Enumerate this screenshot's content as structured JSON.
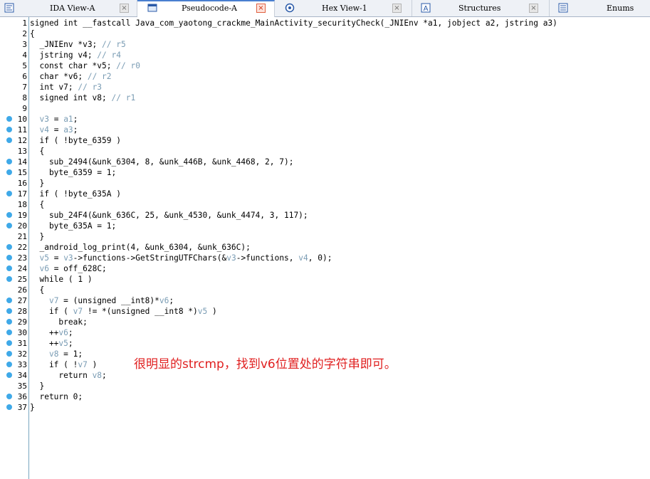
{
  "tabs": [
    {
      "label": "IDA View-A",
      "icon": "ida-view-icon",
      "active": false
    },
    {
      "label": "Pseudocode-A",
      "icon": "pseudocode-icon",
      "active": true
    },
    {
      "label": "Hex View-1",
      "icon": "hex-view-icon",
      "active": false
    },
    {
      "label": "Structures",
      "icon": "structures-icon",
      "active": false
    },
    {
      "label": "Enums",
      "icon": "enums-icon",
      "active": false
    }
  ],
  "close_glyph": "×",
  "colors": {
    "breakpoint_dot": "#3fa9e8",
    "variable": "#7a9cb4",
    "annotation": "#e02020"
  },
  "code_lines": [
    {
      "n": "1",
      "dot": false,
      "tokens": [
        [
          "t",
          "signed int __fastcall Java_com_yaotong_crackme_MainActivity_securityCheck(_JNIEnv *a1, jobject a2, jstring a3)"
        ]
      ]
    },
    {
      "n": "2",
      "dot": false,
      "tokens": [
        [
          "t",
          "{"
        ]
      ]
    },
    {
      "n": "3",
      "dot": false,
      "tokens": [
        [
          "t",
          "  _JNIEnv *v3; "
        ],
        [
          "c",
          "// r5"
        ]
      ]
    },
    {
      "n": "4",
      "dot": false,
      "tokens": [
        [
          "t",
          "  jstring v4; "
        ],
        [
          "c",
          "// r4"
        ]
      ]
    },
    {
      "n": "5",
      "dot": false,
      "tokens": [
        [
          "t",
          "  const char *v5; "
        ],
        [
          "c",
          "// r0"
        ]
      ]
    },
    {
      "n": "6",
      "dot": false,
      "tokens": [
        [
          "t",
          "  char *v6; "
        ],
        [
          "c",
          "// r2"
        ]
      ]
    },
    {
      "n": "7",
      "dot": false,
      "tokens": [
        [
          "t",
          "  int v7; "
        ],
        [
          "c",
          "// r3"
        ]
      ]
    },
    {
      "n": "8",
      "dot": false,
      "tokens": [
        [
          "t",
          "  signed int v8; "
        ],
        [
          "c",
          "// r1"
        ]
      ]
    },
    {
      "n": "9",
      "dot": false,
      "tokens": [
        [
          "t",
          ""
        ]
      ]
    },
    {
      "n": "10",
      "dot": true,
      "tokens": [
        [
          "t",
          "  "
        ],
        [
          "v",
          "v3"
        ],
        [
          "t",
          " = "
        ],
        [
          "v",
          "a1"
        ],
        [
          "t",
          ";"
        ]
      ]
    },
    {
      "n": "11",
      "dot": true,
      "tokens": [
        [
          "t",
          "  "
        ],
        [
          "v",
          "v4"
        ],
        [
          "t",
          " = "
        ],
        [
          "v",
          "a3"
        ],
        [
          "t",
          ";"
        ]
      ]
    },
    {
      "n": "12",
      "dot": true,
      "tokens": [
        [
          "t",
          "  if ( !byte_6359 )"
        ]
      ]
    },
    {
      "n": "13",
      "dot": false,
      "tokens": [
        [
          "t",
          "  {"
        ]
      ]
    },
    {
      "n": "14",
      "dot": true,
      "tokens": [
        [
          "t",
          "    sub_2494(&unk_6304, 8, &unk_446B, &unk_4468, 2, 7);"
        ]
      ]
    },
    {
      "n": "15",
      "dot": true,
      "tokens": [
        [
          "t",
          "    byte_6359 = 1;"
        ]
      ]
    },
    {
      "n": "16",
      "dot": false,
      "tokens": [
        [
          "t",
          "  }"
        ]
      ]
    },
    {
      "n": "17",
      "dot": true,
      "tokens": [
        [
          "t",
          "  if ( !byte_635A )"
        ]
      ]
    },
    {
      "n": "18",
      "dot": false,
      "tokens": [
        [
          "t",
          "  {"
        ]
      ]
    },
    {
      "n": "19",
      "dot": true,
      "tokens": [
        [
          "t",
          "    sub_24F4(&unk_636C, 25, &unk_4530, &unk_4474, 3, 117);"
        ]
      ]
    },
    {
      "n": "20",
      "dot": true,
      "tokens": [
        [
          "t",
          "    byte_635A = 1;"
        ]
      ]
    },
    {
      "n": "21",
      "dot": false,
      "tokens": [
        [
          "t",
          "  }"
        ]
      ]
    },
    {
      "n": "22",
      "dot": true,
      "tokens": [
        [
          "t",
          "  _android_log_print(4, &unk_6304, &unk_636C);"
        ]
      ]
    },
    {
      "n": "23",
      "dot": true,
      "tokens": [
        [
          "t",
          "  "
        ],
        [
          "v",
          "v5"
        ],
        [
          "t",
          " = "
        ],
        [
          "v",
          "v3"
        ],
        [
          "t",
          "->functions->GetStringUTFChars(&"
        ],
        [
          "v",
          "v3"
        ],
        [
          "t",
          "->functions, "
        ],
        [
          "v",
          "v4"
        ],
        [
          "t",
          ", 0);"
        ]
      ]
    },
    {
      "n": "24",
      "dot": true,
      "tokens": [
        [
          "t",
          "  "
        ],
        [
          "v",
          "v6"
        ],
        [
          "t",
          " = off_628C;"
        ]
      ]
    },
    {
      "n": "25",
      "dot": true,
      "tokens": [
        [
          "t",
          "  while ( 1 )"
        ]
      ]
    },
    {
      "n": "26",
      "dot": false,
      "tokens": [
        [
          "t",
          "  {"
        ]
      ]
    },
    {
      "n": "27",
      "dot": true,
      "tokens": [
        [
          "t",
          "    "
        ],
        [
          "v",
          "v7"
        ],
        [
          "t",
          " = (unsigned __int8)*"
        ],
        [
          "v",
          "v6"
        ],
        [
          "t",
          ";"
        ]
      ]
    },
    {
      "n": "28",
      "dot": true,
      "tokens": [
        [
          "t",
          "    if ( "
        ],
        [
          "v",
          "v7"
        ],
        [
          "t",
          " != *(unsigned __int8 *)"
        ],
        [
          "v",
          "v5"
        ],
        [
          "t",
          " )"
        ]
      ]
    },
    {
      "n": "29",
      "dot": true,
      "tokens": [
        [
          "t",
          "      break;"
        ]
      ]
    },
    {
      "n": "30",
      "dot": true,
      "tokens": [
        [
          "t",
          "    ++"
        ],
        [
          "v",
          "v6"
        ],
        [
          "t",
          ";"
        ]
      ]
    },
    {
      "n": "31",
      "dot": true,
      "tokens": [
        [
          "t",
          "    ++"
        ],
        [
          "v",
          "v5"
        ],
        [
          "t",
          ";"
        ]
      ]
    },
    {
      "n": "32",
      "dot": true,
      "tokens": [
        [
          "t",
          "    "
        ],
        [
          "v",
          "v8"
        ],
        [
          "t",
          " = 1;"
        ]
      ]
    },
    {
      "n": "33",
      "dot": true,
      "tokens": [
        [
          "t",
          "    if ( !"
        ],
        [
          "v",
          "v7"
        ],
        [
          "t",
          " )"
        ]
      ]
    },
    {
      "n": "34",
      "dot": true,
      "tokens": [
        [
          "t",
          "      return "
        ],
        [
          "v",
          "v8"
        ],
        [
          "t",
          ";"
        ]
      ]
    },
    {
      "n": "35",
      "dot": false,
      "tokens": [
        [
          "t",
          "  }"
        ]
      ]
    },
    {
      "n": "36",
      "dot": true,
      "tokens": [
        [
          "t",
          "  return 0;"
        ]
      ]
    },
    {
      "n": "37",
      "dot": true,
      "tokens": [
        [
          "t",
          "}"
        ]
      ]
    }
  ],
  "annotation": "很明显的strcmp，找到v6位置处的字符串即可。"
}
